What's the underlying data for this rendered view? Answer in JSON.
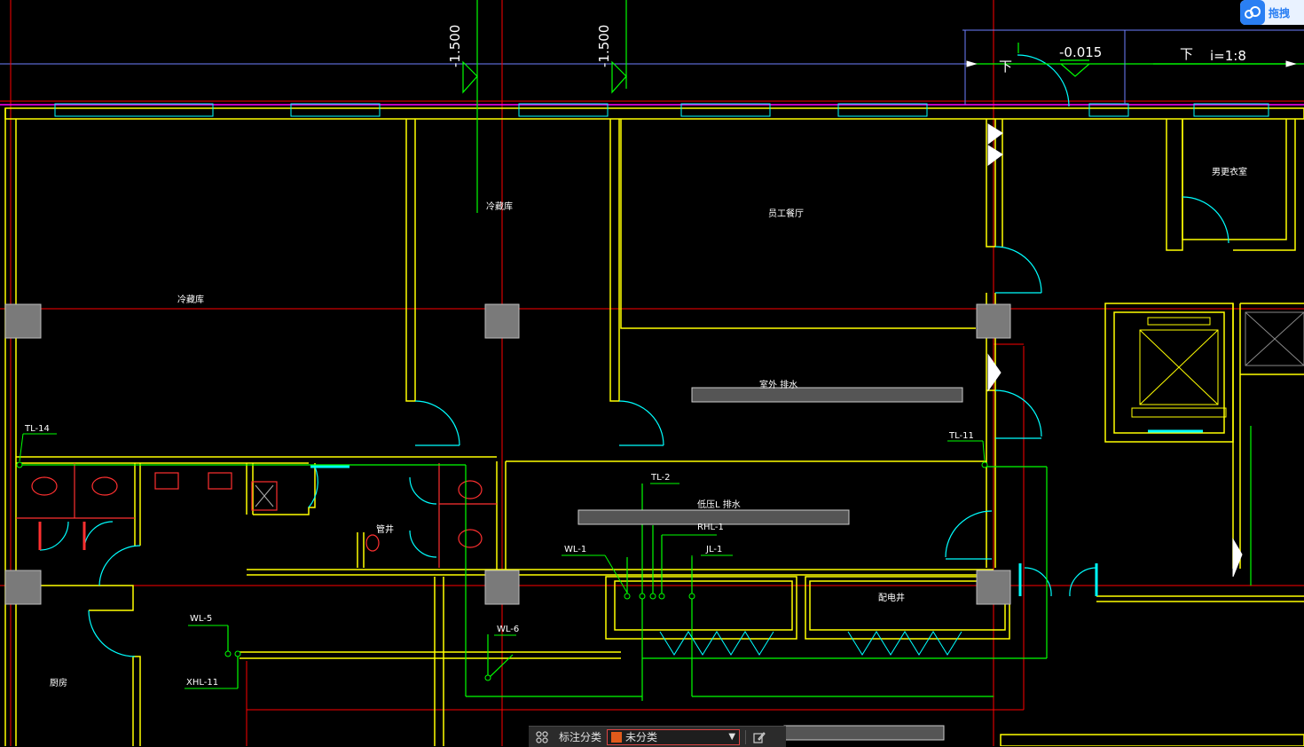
{
  "badge": {
    "text": "拖拽",
    "icon": "cloud-logo-icon"
  },
  "annotation_toolbar": {
    "title": "标注分类",
    "selected": "未分类",
    "swatch_color": "#e05a1b",
    "left_icon": "grid-icon",
    "right_icon": "edit-note-icon",
    "caret_icon": "chevron-down-icon"
  },
  "levels": {
    "l1": "-1.500",
    "l2": "-1.500",
    "l3": "-0.015",
    "down1": "下",
    "down2": "下",
    "slope": "i=1:8"
  },
  "rooms": {
    "r1": "冷藏库",
    "r2": "冷藏库",
    "r3": "员工餐厅",
    "r4": "男更衣室",
    "r5": "厨房",
    "r6": "管井",
    "r7": "配电井",
    "c1": "室外  排水",
    "c2": "低压L  排水"
  },
  "pipes": {
    "p1": "TL-14",
    "p2": "TL-11",
    "p3": "TL-2",
    "p4": "RHL-1",
    "p5": "WL-1",
    "p6": "JL-1",
    "p7": "WL-5",
    "p8": "XHL-11",
    "p9": "WL-6"
  },
  "colors": {
    "wall": "#ffff00",
    "axis": "#ff0000",
    "door": "#00ffff",
    "pipe": "#00ff00",
    "fixture": "#ff3030"
  }
}
